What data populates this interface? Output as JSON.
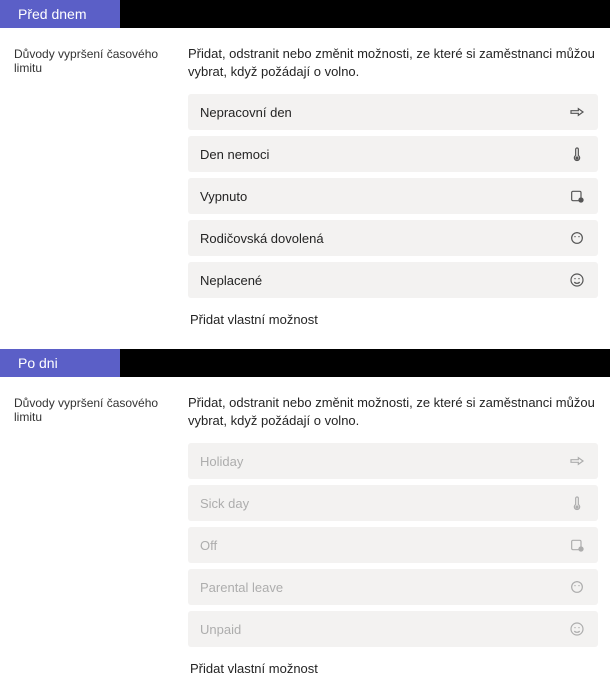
{
  "sections": [
    {
      "tab": "Před dnem",
      "sidelabel": "Důvody vypršení časového limitu",
      "description": "Přidat, odstranit nebo změnit možnosti, ze které si zaměstnanci můžou vybrat, když požádají o volno.",
      "faded": false,
      "options": [
        {
          "label": "Nepracovní den",
          "icon": "plane-icon"
        },
        {
          "label": "Den nemoci",
          "icon": "thermometer-icon"
        },
        {
          "label": "Vypnuto",
          "icon": "calendar-off-icon"
        },
        {
          "label": "Rodičovská dovolená",
          "icon": "baby-icon"
        },
        {
          "label": "Neplacené",
          "icon": "smiley-icon"
        }
      ],
      "add_custom": "Přidat vlastní možnost"
    },
    {
      "tab": "Po dni",
      "sidelabel": "Důvody vypršení časového limitu",
      "description": "Přidat, odstranit nebo změnit možnosti, ze které si zaměstnanci můžou vybrat, když požádají o volno.",
      "faded": true,
      "options": [
        {
          "label": "Holiday",
          "icon": "plane-icon"
        },
        {
          "label": "Sick day",
          "icon": "thermometer-icon"
        },
        {
          "label": "Off",
          "icon": "calendar-off-icon"
        },
        {
          "label": "Parental leave",
          "icon": "baby-icon"
        },
        {
          "label": "Unpaid",
          "icon": "smiley-icon"
        }
      ],
      "add_custom": "Přidat vlastní možnost"
    }
  ]
}
